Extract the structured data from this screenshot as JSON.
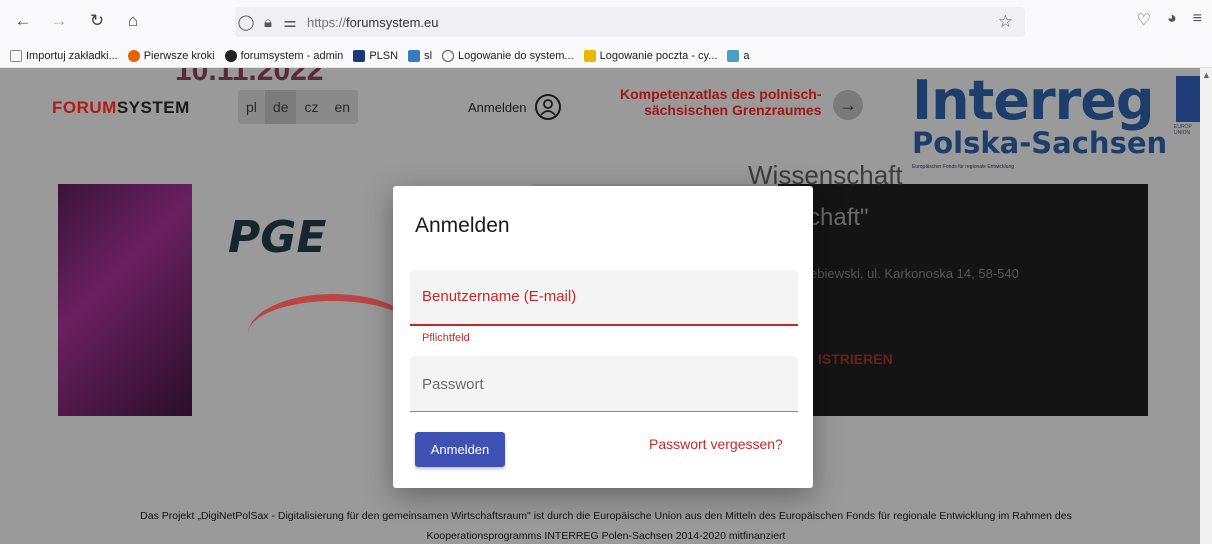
{
  "browser": {
    "url_prefix": "https://",
    "url_domain": "forumsystem.eu",
    "bookmarks": [
      {
        "label": "Importuj zakładki...",
        "color": "#888888"
      },
      {
        "label": "Pierwsze kroki",
        "color": "#e66000"
      },
      {
        "label": "forumsystem - admin",
        "color": "#222222"
      },
      {
        "label": "PLSN",
        "color": "#1a3a7a"
      },
      {
        "label": "sl",
        "color": "#3a7ac0"
      },
      {
        "label": "Logowanie do system...",
        "color": "#555555"
      },
      {
        "label": "Logowanie poczta - cy...",
        "color": "#e6b800"
      },
      {
        "label": "a",
        "color": "#4aa0c0"
      }
    ]
  },
  "site": {
    "logo_red": "FORUM",
    "logo_dark": "SYSTEM",
    "languages": [
      {
        "code": "pl",
        "active": false
      },
      {
        "code": "de",
        "active": true
      },
      {
        "code": "cz",
        "active": false
      },
      {
        "code": "en",
        "active": false
      }
    ],
    "login_link": "Anmelden",
    "atlas_line1": "Kompetenzatlas des polnisch-",
    "atlas_line2": "sächsischen Grenzraumes",
    "interreg_big": "Interreg",
    "interreg_sub": "Polska-Sachsen",
    "interreg_tiny": "Europäischer Fonds für regionale Entwicklung",
    "eu_text_1": "EUROP",
    "eu_text_2": "UNION"
  },
  "banner": {
    "date": "10.11.2022",
    "pge": "PGE",
    "dark_line1": "Wissenschaft",
    "dark_line2": "schaft\"",
    "dark_line3": "ebiewski, ul. Karkonoska 14, 58-540",
    "dark_line4": "ISTRIEREN"
  },
  "footer": {
    "line1": "Das Projekt „DigiNetPolSax - Digitalisierung für den gemeinsamen Wirtschaftsraum\" ist durch die Europäische Union aus den Mitteln des Europäischen Fonds für regionale Entwicklung im Rahmen des",
    "line2": "Kooperationsprogramms INTERREG Polen-Sachsen 2014-2020 mitfinanziert"
  },
  "modal": {
    "title": "Anmelden",
    "username_placeholder": "Benutzername (E-mail)",
    "username_error": "Pflichtfeld",
    "password_placeholder": "Passwort",
    "submit_label": "Anmelden",
    "forgot_label": "Passwort vergessen?"
  },
  "colors": {
    "accent_button": "#3f51b5",
    "error_red": "#c62828",
    "brand_red": "#b31b1b",
    "interreg_blue": "#1d3d6b"
  }
}
